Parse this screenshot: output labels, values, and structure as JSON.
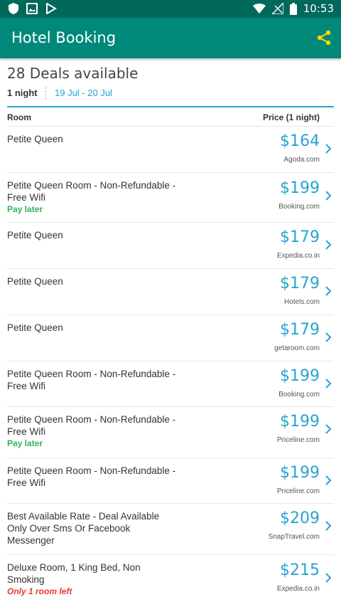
{
  "status_bar": {
    "time": "10:53",
    "left_icons": [
      "shield-icon",
      "image-icon",
      "play-store-icon"
    ],
    "right_icons": [
      "wifi-icon",
      "no-signal-icon",
      "battery-icon"
    ]
  },
  "app_bar": {
    "title": "Hotel Booking",
    "share_icon": "share-icon",
    "share_color": "#ffd600"
  },
  "summary": {
    "deals_count": "28 Deals available",
    "nights": "1 night",
    "dates": "19 Jul - 20 Jul"
  },
  "columns": {
    "room": "Room",
    "price": "Price (1 night)"
  },
  "colors": {
    "status_bar": "#00695c",
    "app_bar": "#00897b",
    "accent": "#29a3d1",
    "pay_later": "#2fb35a",
    "rooms_left": "#e53935"
  },
  "deals": [
    {
      "room": "Petite Queen",
      "tag": "",
      "tag_type": "",
      "price": "$164",
      "provider": "Agoda.com"
    },
    {
      "room": "Petite Queen Room - Non-Refundable - Free Wifi",
      "tag": "Pay later",
      "tag_type": "green",
      "price": "$199",
      "provider": "Booking.com"
    },
    {
      "room": "Petite Queen",
      "tag": "",
      "tag_type": "",
      "price": "$179",
      "provider": "Expedia.co.in"
    },
    {
      "room": "Petite Queen",
      "tag": "",
      "tag_type": "",
      "price": "$179",
      "provider": "Hotels.com"
    },
    {
      "room": "Petite Queen",
      "tag": "",
      "tag_type": "",
      "price": "$179",
      "provider": "getaroom.com"
    },
    {
      "room": "Petite Queen Room - Non-Refundable - Free Wifi",
      "tag": "",
      "tag_type": "",
      "price": "$199",
      "provider": "Booking.com"
    },
    {
      "room": "Petite Queen Room - Non-Refundable - Free Wifi",
      "tag": "Pay later",
      "tag_type": "green",
      "price": "$199",
      "provider": "Priceline.com"
    },
    {
      "room": "Petite Queen Room - Non-Refundable - Free Wifi",
      "tag": "",
      "tag_type": "",
      "price": "$199",
      "provider": "Priceline.com"
    },
    {
      "room": "Best Available Rate - Deal Available Only Over Sms Or Facebook Messenger",
      "tag": "",
      "tag_type": "",
      "price": "$209",
      "provider": "SnapTravel.com"
    },
    {
      "room": "Deluxe Room, 1 King Bed, Non Smoking",
      "tag": "Only 1 room left",
      "tag_type": "red",
      "price": "$215",
      "provider": "Expedia.co.in"
    }
  ]
}
